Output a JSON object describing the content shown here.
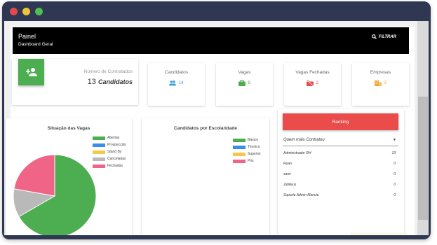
{
  "header": {
    "title": "Painel",
    "subtitle": "Dashboard Geral",
    "filter_label": "FILTRAR"
  },
  "contracted": {
    "label": "Número de Contratados",
    "value": "13",
    "unit": "Candidatos"
  },
  "stats": [
    {
      "label": "Candidatos",
      "value": "14",
      "icon": "people-icon",
      "color": "#3a9bd9"
    },
    {
      "label": "Vagas",
      "value": "9",
      "icon": "briefcase-icon",
      "color": "#4cae50"
    },
    {
      "label": "Vagas Fechadas",
      "value": "2",
      "icon": "briefcase-off-icon",
      "color": "#e84b4b"
    },
    {
      "label": "Empresas",
      "value": "3",
      "icon": "building-icon",
      "color": "#f3a530"
    }
  ],
  "vagas_chart": {
    "title": "Situação das Vagas",
    "legend": [
      {
        "label": "Abertas",
        "color": "#4cae50"
      },
      {
        "label": "Prospecção",
        "color": "#3a8ee6"
      },
      {
        "label": "Stand By",
        "color": "#f5c84b"
      },
      {
        "label": "Canceladas",
        "color": "#b9b9b9"
      },
      {
        "label": "Fechadas",
        "color": "#f06488"
      }
    ]
  },
  "escolaridade_chart": {
    "title": "Candidatos por Escolaridade",
    "legend": [
      {
        "label": "Básico",
        "color": "#4cae50"
      },
      {
        "label": "Técnico",
        "color": "#3a8ee6"
      },
      {
        "label": "Superior",
        "color": "#f5c84b"
      },
      {
        "label": "Pós",
        "color": "#f06488"
      }
    ]
  },
  "chart_data": {
    "type": "pie",
    "title": "Situação das Vagas",
    "categories": [
      "Abertas",
      "Prospecção",
      "Stand By",
      "Canceladas",
      "Fechadas"
    ],
    "values": [
      6,
      0,
      0,
      1,
      2
    ]
  },
  "ranking": {
    "button_label": "Ranking",
    "select_value": "Quem mais Contratou",
    "rows": [
      {
        "name": "Administrador RH",
        "count": "13"
      },
      {
        "name": "Ruan",
        "count": "0"
      },
      {
        "name": "sami",
        "count": "0"
      },
      {
        "name": "Jubileus",
        "count": "0"
      },
      {
        "name": "Suporte Admin Menvie",
        "count": "0"
      }
    ]
  }
}
